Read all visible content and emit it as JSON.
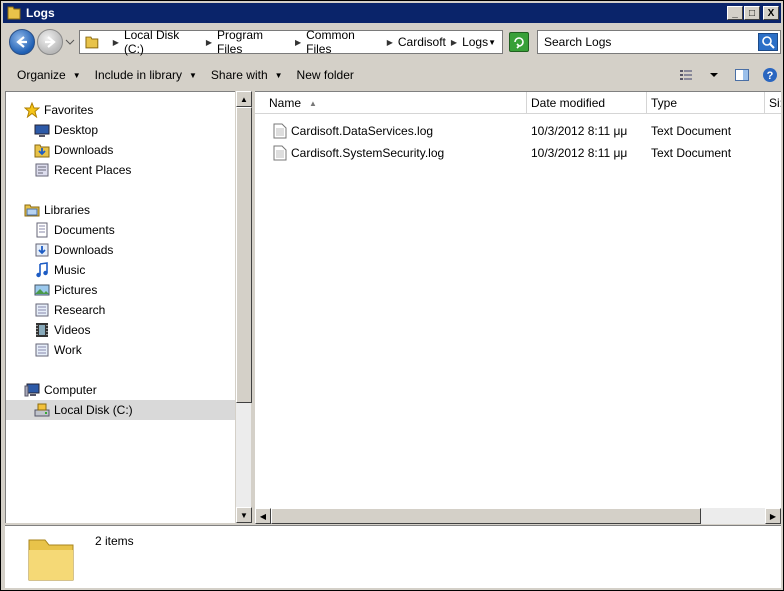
{
  "window": {
    "title": "Logs"
  },
  "title_buttons": {
    "minimize": "_",
    "maximize": "□",
    "close": "X"
  },
  "address": {
    "crumbs": [
      "Local Disk (C:)",
      "Program Files",
      "Common Files",
      "Cardisoft",
      "Logs"
    ]
  },
  "search": {
    "placeholder": "Search Logs"
  },
  "commands": {
    "organize": "Organize",
    "include_in_library": "Include in library",
    "share_with": "Share with",
    "new_folder": "New folder"
  },
  "nav": {
    "favorites": {
      "label": "Favorites",
      "items": [
        "Desktop",
        "Downloads",
        "Recent Places"
      ]
    },
    "libraries": {
      "label": "Libraries",
      "items": [
        "Documents",
        "Downloads",
        "Music",
        "Pictures",
        "Research",
        "Videos",
        "Work"
      ]
    },
    "computer": {
      "label": "Computer",
      "items": [
        "Local Disk (C:)"
      ]
    }
  },
  "columns": {
    "name": "Name",
    "date": "Date modified",
    "type": "Type",
    "size": "Si:"
  },
  "files": [
    {
      "name": "Cardisoft.DataServices.log",
      "date": "10/3/2012 8:11 μμ",
      "type": "Text Document"
    },
    {
      "name": "Cardisoft.SystemSecurity.log",
      "date": "10/3/2012 8:11 μμ",
      "type": "Text Document"
    }
  ],
  "status": {
    "count": "2 items"
  },
  "colors": {
    "titlebar": "#0a246a",
    "selection": "#d9d9d9",
    "chrome": "#d4d0c8"
  },
  "icons": {
    "folder": "folder-icon",
    "star": "star-icon",
    "desktop": "desktop-icon",
    "downloads": "downloads-icon",
    "recent": "recent-places-icon",
    "library": "library-icon",
    "computer": "computer-icon",
    "drive": "drive-icon"
  }
}
